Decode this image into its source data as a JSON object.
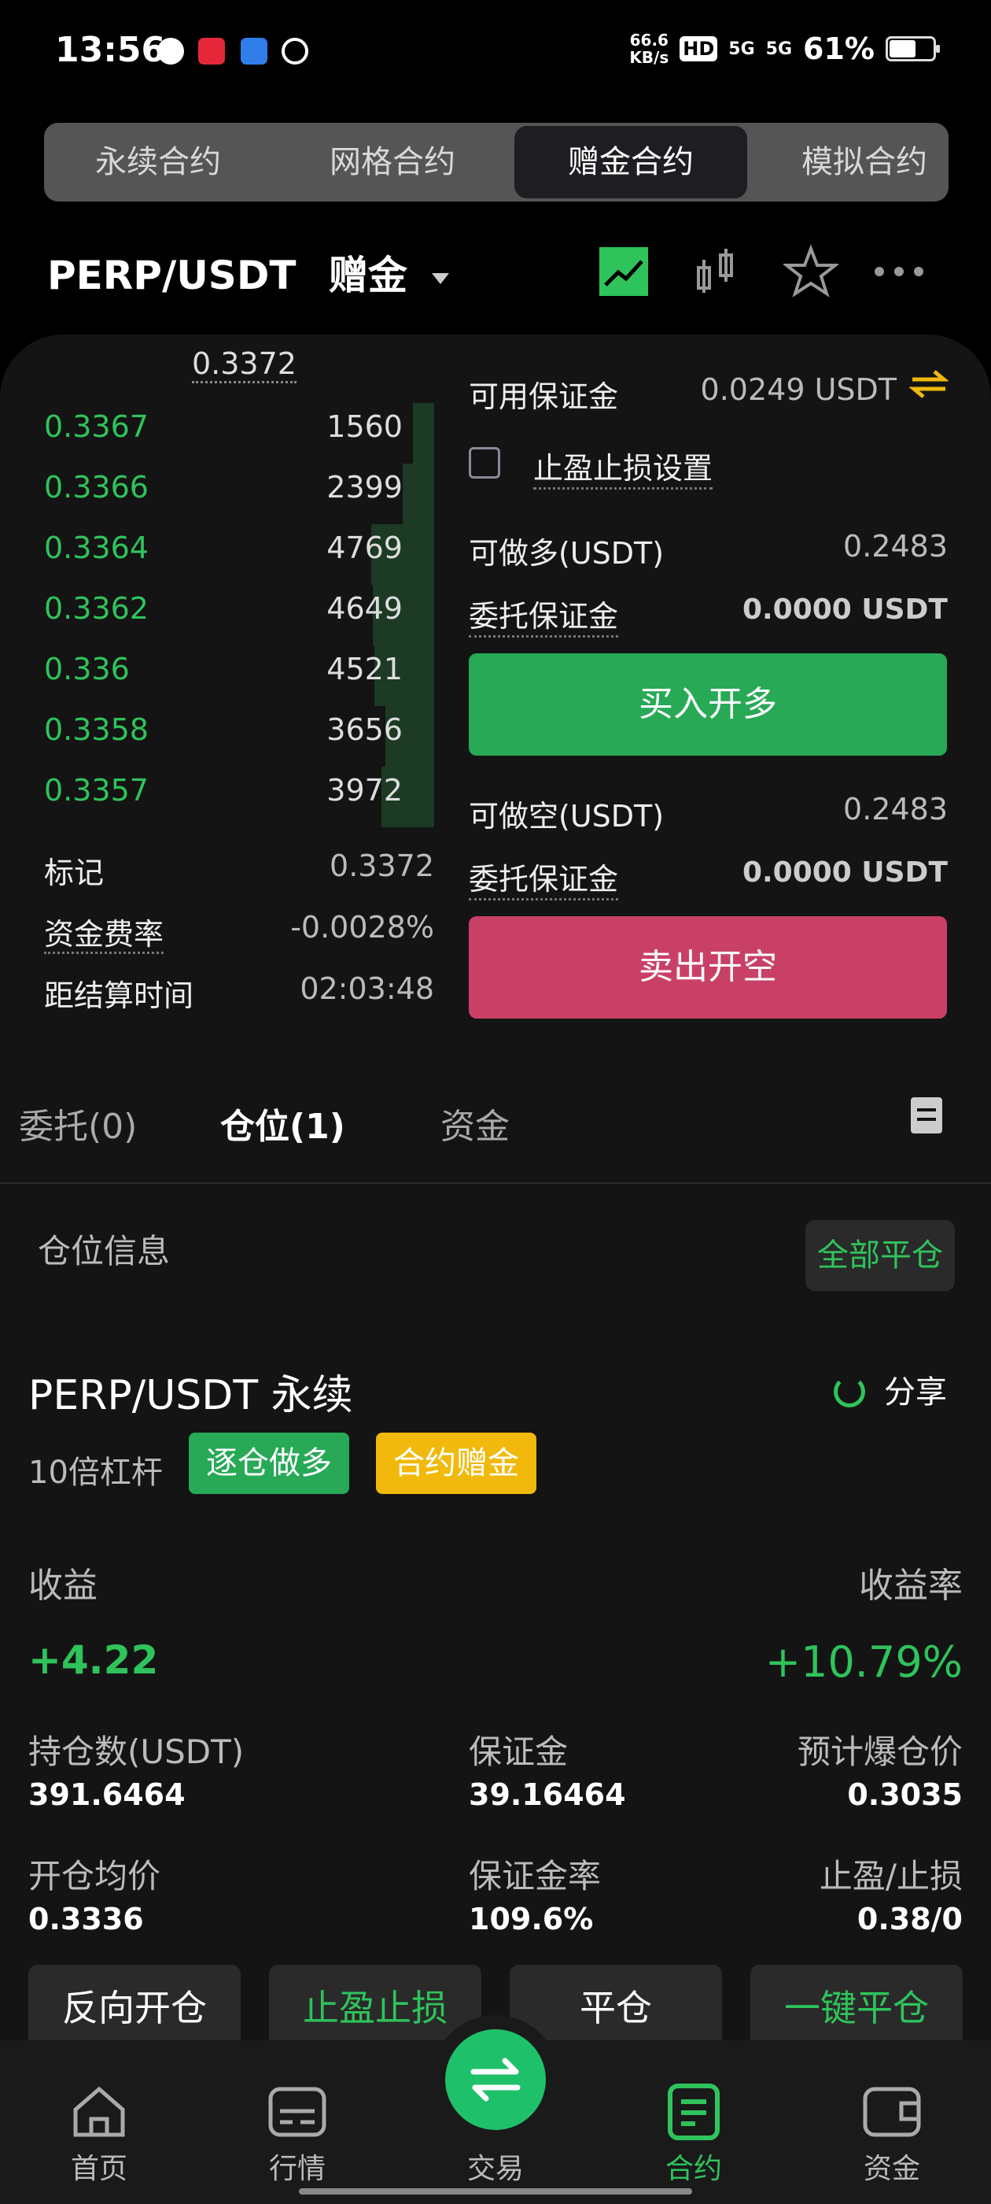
{
  "status_bar": {
    "time": "13:56",
    "net_speed_top": "66.6",
    "net_speed_bottom": "KB/s",
    "hd": "HD",
    "signal_1": "5G",
    "signal_2": "5G",
    "battery": "61%",
    "battery_level": 0.61
  },
  "top_tabs": [
    "永续合约",
    "网格合约",
    "赠金合约",
    "模拟合约"
  ],
  "active_top_tab": "赠金合约",
  "header": {
    "pair": "PERP/USDT",
    "bonus": "赠金"
  },
  "orderbook": {
    "last_price": "0.3372",
    "rows": [
      {
        "price": "0.3367",
        "qty": "1560",
        "depth": 0.12
      },
      {
        "price": "0.3366",
        "qty": "2399",
        "depth": 0.18
      },
      {
        "price": "0.3364",
        "qty": "4769",
        "depth": 0.36
      },
      {
        "price": "0.3362",
        "qty": "4649",
        "depth": 0.35
      },
      {
        "price": "0.336",
        "qty": "4521",
        "depth": 0.34
      },
      {
        "price": "0.3358",
        "qty": "3656",
        "depth": 0.28
      },
      {
        "price": "0.3357",
        "qty": "3972",
        "depth": 0.3
      }
    ],
    "mark_label": "标记",
    "mark_value": "0.3372",
    "funding_label": "资金费率",
    "funding_value": "-0.0028%",
    "settle_label": "距结算时间",
    "settle_value": "02:03:48"
  },
  "trade": {
    "avail_label": "可用保证金",
    "avail_value": "0.0249 USDT",
    "tpsl_label": "止盈止损设置",
    "long_label": "可做多(USDT)",
    "long_value": "0.2483",
    "order_margin_label": "委托保证金",
    "order_margin_value": "0.0000 USDT",
    "buy_button": "买入开多",
    "short_label": "可做空(USDT)",
    "short_value": "0.2483",
    "order_margin_label_2": "委托保证金",
    "order_margin_value_2": "0.0000 USDT",
    "sell_button": "卖出开空"
  },
  "lower_tabs": [
    "委托(0)",
    "仓位(1)",
    "资金"
  ],
  "position": {
    "section_title": "仓位信息",
    "close_all": "全部平仓",
    "title": "PERP/USDT 永续",
    "share": "分享",
    "leverage": "10倍杠杆",
    "tag_side": "逐仓做多",
    "tag_bonus": "合约赠金",
    "pnl_label": "收益",
    "pnl_value": "+4.22",
    "roe_label": "收益率",
    "roe_value": "+10.79%",
    "size_label": "持仓数(USDT)",
    "size_value": "391.6464",
    "margin_label": "保证金",
    "margin_value": "39.16464",
    "liq_label": "预计爆仓价",
    "liq_value": "0.3035",
    "entry_label": "开仓均价",
    "entry_value": "0.3336",
    "margin_ratio_label": "保证金率",
    "margin_ratio_value": "109.6%",
    "tpsl_label": "止盈/止损",
    "tpsl_value": "0.38/0"
  },
  "actions": [
    "反向开仓",
    "止盈止损",
    "平仓",
    "一键平仓"
  ],
  "bottom_nav": [
    "首页",
    "行情",
    "交易",
    "合约",
    "资金"
  ],
  "colors": {
    "green": "#2fc35b",
    "buy": "#27a956",
    "sell": "#c94066",
    "tag_yellow": "#f0b90b"
  }
}
